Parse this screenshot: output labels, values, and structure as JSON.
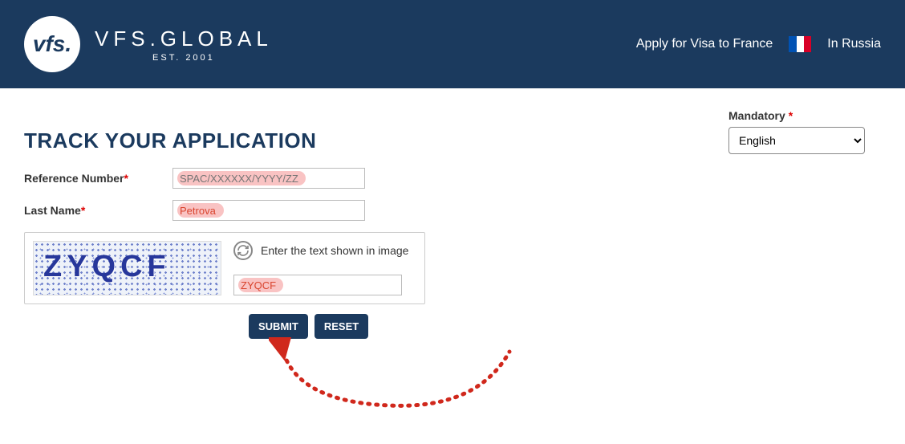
{
  "header": {
    "logo_text": "vfs.",
    "brand_name": "VFS.GLOBAL",
    "brand_est": "EST. 2001",
    "apply_text": "Apply for Visa to France",
    "location_text": "In Russia"
  },
  "sidebar": {
    "mandatory_label": "Mandatory",
    "language_value": "English"
  },
  "page": {
    "title": "TRACK YOUR APPLICATION"
  },
  "form": {
    "ref_label": "Reference Number",
    "ref_placeholder": "SPAC/XXXXXX/YYYY/ZZ",
    "ref_value": "",
    "lastname_label": "Last Name",
    "lastname_value": "Petrova",
    "captcha_label": "Enter the text shown in image",
    "captcha_image_text": "ZYQCF",
    "captcha_value": "ZYQCF",
    "submit_label": "SUBMIT",
    "reset_label": "RESET"
  }
}
